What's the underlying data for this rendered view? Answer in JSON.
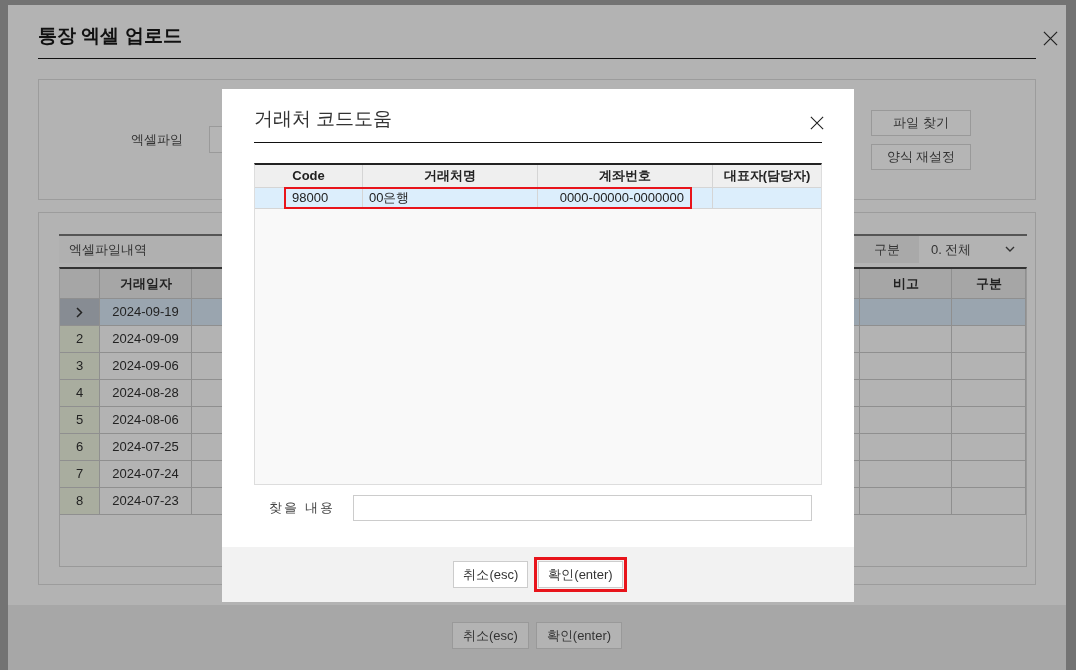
{
  "upload_dialog": {
    "title": "통장 엑셀 업로드",
    "file_label": "엑셀파일",
    "side_buttons": [
      "파일 찾기",
      "양식 재설정"
    ],
    "section_title": "엑셀파일내역",
    "filter": {
      "label": "구분",
      "value": "0. 전체"
    },
    "table": {
      "columns": [
        {
          "kind": "date",
          "label": "거래일자"
        },
        {
          "kind": "hidden"
        },
        {
          "kind": "note",
          "label": "비고"
        },
        {
          "kind": "type",
          "label": "구분"
        }
      ],
      "rows": [
        {
          "current": true,
          "number": "",
          "date": "2024-09-19"
        },
        {
          "current": false,
          "number": "2",
          "date": "2024-09-09"
        },
        {
          "current": false,
          "number": "3",
          "date": "2024-09-06"
        },
        {
          "current": false,
          "number": "4",
          "date": "2024-08-28"
        },
        {
          "current": false,
          "number": "5",
          "date": "2024-08-06"
        },
        {
          "current": false,
          "number": "6",
          "date": "2024-07-25"
        },
        {
          "current": false,
          "number": "7",
          "date": "2024-07-24"
        },
        {
          "current": false,
          "number": "8",
          "date": "2024-07-23"
        }
      ]
    },
    "buttons": [
      "취소(esc)",
      "확인(enter)"
    ]
  },
  "code_help_dialog": {
    "title": "거래처 코드도움",
    "columns": [
      "Code",
      "거래처명",
      "계좌번호",
      "대표자(담당자)"
    ],
    "rows": [
      {
        "selected": true,
        "annotated": true,
        "code": "98000",
        "name": "00은행",
        "account": "0000-00000-0000000"
      }
    ],
    "search_label": "찾을 내용",
    "buttons": [
      {
        "label": "취소(esc)",
        "annotated": false
      },
      {
        "label": "확인(enter)",
        "annotated": true
      }
    ]
  }
}
